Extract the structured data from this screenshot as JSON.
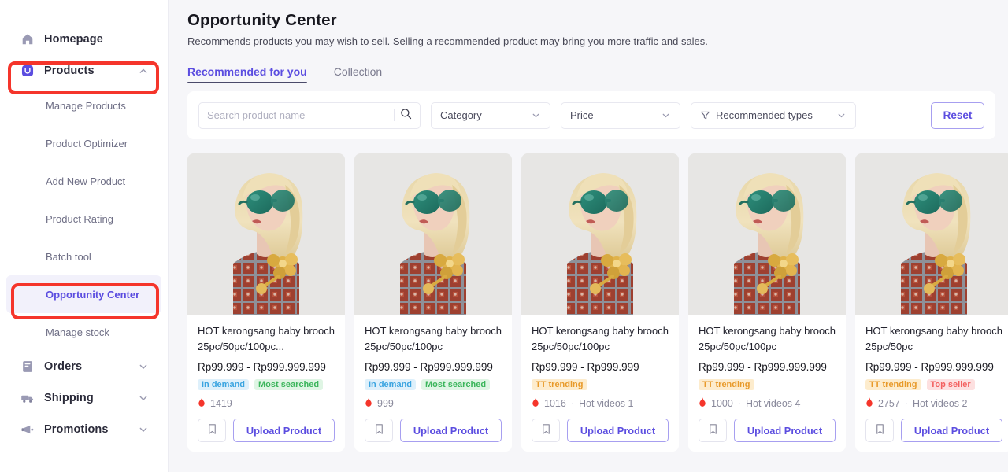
{
  "sidebar": {
    "groups": [
      {
        "label": "Homepage",
        "icon": "home-icon",
        "expandable": false,
        "active": false
      },
      {
        "label": "Products",
        "icon": "shopping-bag-icon",
        "expandable": true,
        "expanded": true,
        "chevron": "chevron-up-icon",
        "children": [
          {
            "label": "Manage Products",
            "active": false
          },
          {
            "label": "Product Optimizer",
            "active": false
          },
          {
            "label": "Add New Product",
            "active": false
          },
          {
            "label": "Product Rating",
            "active": false
          },
          {
            "label": "Batch tool",
            "active": false
          },
          {
            "label": "Opportunity Center",
            "active": true
          },
          {
            "label": "Manage stock",
            "active": false
          }
        ]
      },
      {
        "label": "Orders",
        "icon": "orders-icon",
        "expandable": true,
        "expanded": false,
        "chevron": "chevron-down-icon"
      },
      {
        "label": "Shipping",
        "icon": "truck-icon",
        "expandable": true,
        "expanded": false,
        "chevron": "chevron-down-icon"
      },
      {
        "label": "Promotions",
        "icon": "megaphone-icon",
        "expandable": true,
        "expanded": false,
        "chevron": "chevron-down-icon"
      }
    ],
    "highlight_color": "#f5352b",
    "active_color": "#5b4de0"
  },
  "header": {
    "title": "Opportunity Center",
    "subtitle": "Recommends products you may wish to sell. Selling a recommended product may bring you more traffic and sales."
  },
  "tabs": [
    {
      "label": "Recommended for you",
      "active": true
    },
    {
      "label": "Collection",
      "active": false
    }
  ],
  "filters": {
    "search": {
      "value": "",
      "placeholder": "Search product name",
      "icon": "search-icon"
    },
    "category": {
      "label": "Category",
      "icon": "chevron-down-icon"
    },
    "price": {
      "label": "Price",
      "icon": "chevron-down-icon"
    },
    "recommended_types": {
      "label": "Recommended types",
      "leading_icon": "funnel-icon",
      "icon": "chevron-down-icon"
    },
    "reset_label": "Reset"
  },
  "products": [
    {
      "name": "HOT kerongsang baby brooch 25pc/50pc/100pc...",
      "price": "Rp99.999 - Rp999.999.999",
      "badges": [
        {
          "text": "In demand",
          "style": "b-indemand"
        },
        {
          "text": "Most searched",
          "style": "b-mostsearched"
        }
      ],
      "hot_count": "1419",
      "hot_videos": "",
      "bookmark_icon": "bookmark-icon",
      "upload_label": "Upload Product",
      "image_alt": "model-with-green-sunglasses-and-gold-brooch"
    },
    {
      "name": "HOT kerongsang baby brooch 25pc/50pc/100pc",
      "price": "Rp99.999 - Rp999.999.999",
      "badges": [
        {
          "text": "In demand",
          "style": "b-indemand"
        },
        {
          "text": "Most searched",
          "style": "b-mostsearched"
        }
      ],
      "hot_count": "999",
      "hot_videos": "",
      "bookmark_icon": "bookmark-icon",
      "upload_label": "Upload Product",
      "image_alt": "model-with-green-sunglasses-and-gold-brooch"
    },
    {
      "name": "HOT kerongsang baby brooch 25pc/50pc/100pc",
      "price": "Rp99.999 - Rp999.999",
      "badges": [
        {
          "text": "TT trending",
          "style": "b-tttrending"
        }
      ],
      "hot_count": "1016",
      "hot_videos": "Hot videos 1",
      "bookmark_icon": "bookmark-icon",
      "upload_label": "Upload Product",
      "image_alt": "model-with-green-sunglasses-and-gold-brooch"
    },
    {
      "name": "HOT kerongsang baby brooch 25pc/50pc/100pc",
      "price": "Rp99.999 - Rp999.999.999",
      "badges": [
        {
          "text": "TT trending",
          "style": "b-tttrending"
        }
      ],
      "hot_count": "1000",
      "hot_videos": "Hot videos 4",
      "bookmark_icon": "bookmark-icon",
      "upload_label": "Upload Product",
      "image_alt": "model-with-green-sunglasses-and-gold-brooch"
    },
    {
      "name": "HOT kerongsang baby brooch 25pc/50pc",
      "price": "Rp99.999 - Rp999.999.999",
      "badges": [
        {
          "text": "TT trending",
          "style": "b-tttrending"
        },
        {
          "text": "Top seller",
          "style": "b-topseller"
        }
      ],
      "hot_count": "2757",
      "hot_videos": "Hot videos 2",
      "bookmark_icon": "bookmark-icon",
      "upload_label": "Upload Product",
      "image_alt": "model-with-green-sunglasses-and-gold-brooch"
    }
  ]
}
